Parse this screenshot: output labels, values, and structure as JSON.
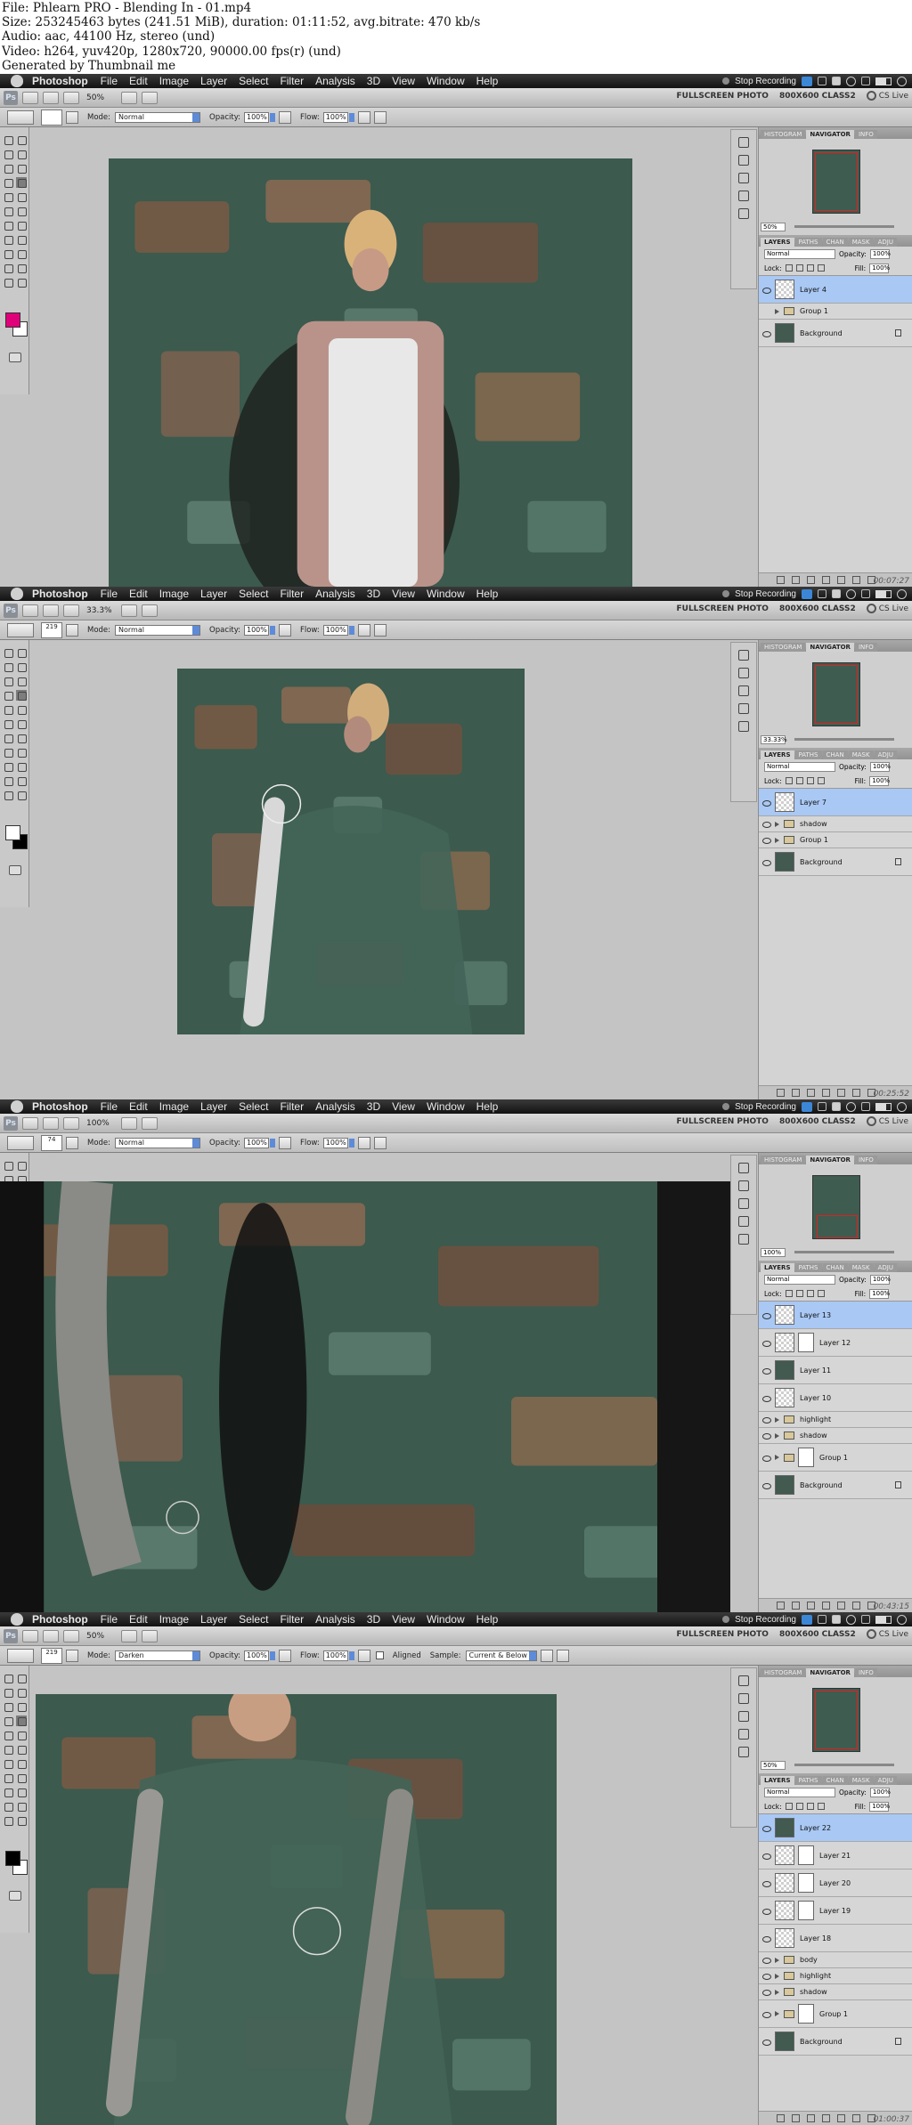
{
  "meta_lines": [
    "File: Phlearn PRO - Blending In - 01.mp4",
    "Size: 253245463 bytes (241.51 MiB), duration: 01:11:52, avg.bitrate: 470 kb/s",
    "Audio: aac, 44100 Hz, stereo (und)",
    "Video: h264, yuv420p, 1280x720, 90000.00 fps(r) (und)",
    "Generated by Thumbnail me"
  ],
  "menu": {
    "app": "Photoshop",
    "items": [
      "File",
      "Edit",
      "Image",
      "Layer",
      "Select",
      "Filter",
      "Analysis",
      "3D",
      "View",
      "Window",
      "Help"
    ],
    "stop_recording": "Stop Recording"
  },
  "appbar": {
    "workspace": "FULLSCREEN PHOTO",
    "preset": "800X600 CLASS2",
    "cs_live": "CS Live"
  },
  "options": {
    "mode_label": "Mode:",
    "opacity_label": "Opacity:",
    "flow_label": "Flow:",
    "opacity": "100%",
    "flow": "100%",
    "aligned_label": "Aligned",
    "sample_label": "Sample:",
    "sample_value": "Current & Below"
  },
  "panels": {
    "tabs_top": [
      "HISTOGRAM",
      "NAVIGATOR",
      "INFO"
    ],
    "tabs_layers": [
      "LAYERS",
      "PATHS",
      "CHAN",
      "MASK",
      "ADJU"
    ],
    "opacity_label": "Opacity:",
    "fill_label": "Fill:",
    "lock_label": "Lock:",
    "pct": "100%"
  },
  "watermarks": [
    "00:07:27",
    "00:25:52",
    "00:43:15",
    "01:00:37"
  ],
  "frames": [
    {
      "zoom": "50%",
      "mode": "Normal",
      "brush_size": "",
      "nav_zoom": "50%",
      "fg_color": "#e0007a",
      "bg_color": "#ffffff",
      "layers": [
        {
          "name": "Layer 4",
          "kind": "layer",
          "selected": true,
          "eye": true
        },
        {
          "name": "Group 1",
          "kind": "group",
          "selected": false,
          "eye": false
        },
        {
          "name": "Background",
          "kind": "photo",
          "selected": false,
          "eye": true,
          "locked": true
        }
      ]
    },
    {
      "zoom": "33.3%",
      "mode": "Normal",
      "brush_size": "219",
      "nav_zoom": "33.33%",
      "fg_color": "#ffffff",
      "bg_color": "#000000",
      "layers": [
        {
          "name": "Layer 7",
          "kind": "layer",
          "selected": true,
          "eye": true
        },
        {
          "name": "shadow",
          "kind": "group",
          "selected": false,
          "eye": true
        },
        {
          "name": "Group 1",
          "kind": "group",
          "selected": false,
          "eye": true
        },
        {
          "name": "Background",
          "kind": "photo",
          "selected": false,
          "eye": true,
          "locked": true
        }
      ]
    },
    {
      "zoom": "100%",
      "mode": "Normal",
      "brush_size": "74",
      "nav_zoom": "100%",
      "fg_color": "#000000",
      "bg_color": "#ffffff",
      "layers": [
        {
          "name": "Layer 13",
          "kind": "layer",
          "selected": true,
          "eye": true
        },
        {
          "name": "Layer 12",
          "kind": "masked",
          "selected": false,
          "eye": true
        },
        {
          "name": "Layer 11",
          "kind": "photo",
          "selected": false,
          "eye": true
        },
        {
          "name": "Layer 10",
          "kind": "layer",
          "selected": false,
          "eye": true
        },
        {
          "name": "highlight",
          "kind": "group",
          "selected": false,
          "eye": true
        },
        {
          "name": "shadow",
          "kind": "group",
          "selected": false,
          "eye": true
        },
        {
          "name": "Group 1",
          "kind": "groupmask",
          "selected": false,
          "eye": true
        },
        {
          "name": "Background",
          "kind": "photo",
          "selected": false,
          "eye": true,
          "locked": true
        }
      ]
    },
    {
      "zoom": "50%",
      "mode": "Darken",
      "brush_size": "219",
      "nav_zoom": "50%",
      "fg_color": "#000000",
      "bg_color": "#ffffff",
      "layers": [
        {
          "name": "Layer 22",
          "kind": "photo",
          "selected": true,
          "eye": true
        },
        {
          "name": "Layer 21",
          "kind": "masked",
          "selected": false,
          "eye": true
        },
        {
          "name": "Layer 20",
          "kind": "masked",
          "selected": false,
          "eye": true
        },
        {
          "name": "Layer 19",
          "kind": "masked",
          "selected": false,
          "eye": true
        },
        {
          "name": "Layer 18",
          "kind": "layer",
          "selected": false,
          "eye": true
        },
        {
          "name": "body",
          "kind": "group",
          "selected": false,
          "eye": true
        },
        {
          "name": "highlight",
          "kind": "group",
          "selected": false,
          "eye": true
        },
        {
          "name": "shadow",
          "kind": "group",
          "selected": false,
          "eye": true
        },
        {
          "name": "Group 1",
          "kind": "groupmask",
          "selected": false,
          "eye": true
        },
        {
          "name": "Background",
          "kind": "photo",
          "selected": false,
          "eye": true,
          "locked": true
        }
      ]
    }
  ]
}
